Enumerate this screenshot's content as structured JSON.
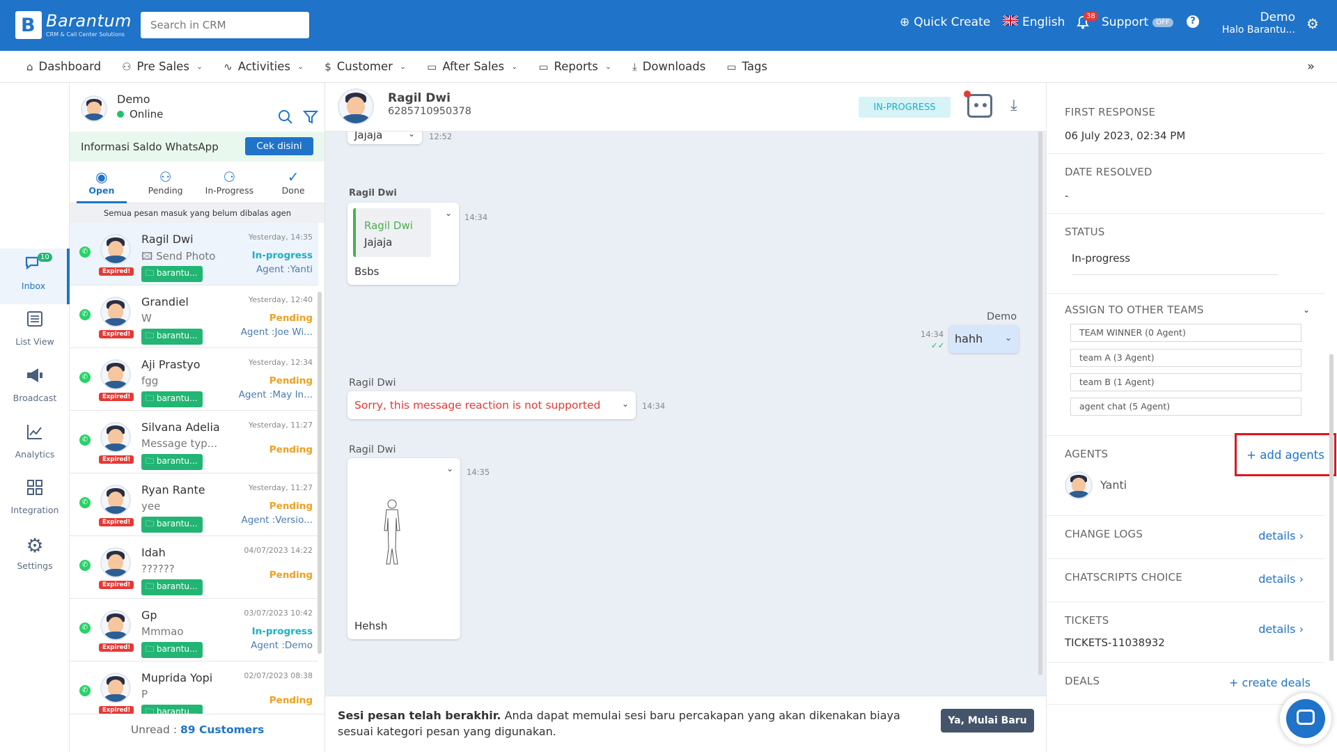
{
  "brand": {
    "name": "Barantum",
    "tagline": "CRM & Call Center Solutions",
    "logo_letter": "B"
  },
  "search": {
    "placeholder": "Search in CRM"
  },
  "topbar": {
    "quick_create": "Quick Create",
    "language": "English",
    "notif_count": "38",
    "support": "Support",
    "support_state": "OFF",
    "help": "?",
    "user_name": "Demo",
    "user_sub": "Halo Barantu..."
  },
  "nav": {
    "items": [
      {
        "label": "Dashboard",
        "icon": "home-icon"
      },
      {
        "label": "Pre Sales",
        "icon": "users-icon",
        "dropdown": true
      },
      {
        "label": "Activities",
        "icon": "activity-icon",
        "dropdown": true
      },
      {
        "label": "Customer",
        "icon": "dollar-icon",
        "dropdown": true
      },
      {
        "label": "After Sales",
        "icon": "folder-icon",
        "dropdown": true
      },
      {
        "label": "Reports",
        "icon": "folder-icon",
        "dropdown": true
      },
      {
        "label": "Downloads",
        "icon": "download-icon"
      },
      {
        "label": "Tags",
        "icon": "folder-icon"
      }
    ],
    "more": "»"
  },
  "rail": {
    "items": [
      {
        "label": "Inbox",
        "badge": "10",
        "active": true
      },
      {
        "label": "List View"
      },
      {
        "label": "Broadcast"
      },
      {
        "label": "Analytics"
      },
      {
        "label": "Integration"
      },
      {
        "label": "Settings"
      }
    ]
  },
  "agent": {
    "name": "Demo",
    "status": "Online"
  },
  "saldo": {
    "text": "Informasi Saldo WhatsApp",
    "button": "Cek disini"
  },
  "tabs": [
    {
      "label": "Open",
      "active": true
    },
    {
      "label": "Pending"
    },
    {
      "label": "In-Progress"
    },
    {
      "label": "Done"
    }
  ],
  "list_note": "Semua pesan masuk yang belum dibalas agen",
  "conversations": [
    {
      "name": "Ragil Dwi",
      "msg": "🖾 Send Photo",
      "time": "Yesterday, 14:35",
      "status": "In-progress",
      "agent": "Agent :Yanti",
      "tag": "barantu...",
      "expired": "Expired!",
      "selected": true
    },
    {
      "name": "Grandiel",
      "msg": "W",
      "time": "Yesterday, 12:40",
      "status": "Pending",
      "agent": "Agent :Joe Wi...",
      "tag": "barantu...",
      "expired": "Expired!"
    },
    {
      "name": "Aji Prastyo",
      "msg": "fgg",
      "time": "Yesterday, 12:34",
      "status": "Pending",
      "agent": "Agent :May In...",
      "tag": "barantu...",
      "expired": "Expired!"
    },
    {
      "name": "Silvana Adelia",
      "msg": "Message typ...",
      "time": "Yesterday, 11:27",
      "status": "Pending",
      "agent": "",
      "tag": "barantu...",
      "expired": "Expired!"
    },
    {
      "name": "Ryan Rante",
      "msg": "yee",
      "time": "Yesterday, 11:27",
      "status": "Pending",
      "agent": "Agent :Versio...",
      "tag": "barantu...",
      "expired": "Expired!"
    },
    {
      "name": "Idah",
      "msg": "??????",
      "time": "04/07/2023 14:22",
      "status": "Pending",
      "agent": "",
      "tag": "barantu...",
      "expired": "Expired!"
    },
    {
      "name": "Gp",
      "msg": "Mmmao",
      "time": "03/07/2023 10:42",
      "status": "In-progress",
      "agent": "Agent :Demo",
      "tag": "barantu...",
      "expired": "Expired!"
    },
    {
      "name": "Muprida Yopi",
      "msg": "P",
      "time": "02/07/2023 08:38",
      "status": "Pending",
      "agent": "",
      "tag": "barantu...",
      "expired": "Expired!"
    }
  ],
  "unread": {
    "label": "Unread :",
    "value": "89 Customers"
  },
  "chat": {
    "contact_name": "Ragil Dwi",
    "contact_phone": "6285710950378",
    "status": "IN-PROGRESS",
    "messages": {
      "m0": {
        "text": "Jajaja",
        "time": "12:52"
      },
      "m1": {
        "sender": "Ragil Dwi",
        "quote_name": "Ragil Dwi",
        "quote_text": "Jajaja",
        "text": "Bsbs",
        "time": "14:34"
      },
      "m2": {
        "sender": "Demo",
        "text": "hahh",
        "time": "14:34"
      },
      "m3": {
        "sender": "Ragil Dwi",
        "text": "Sorry, this message reaction is not supported",
        "time": "14:34"
      },
      "m4": {
        "sender": "Ragil Dwi",
        "caption": "Hehsh",
        "time": "14:35"
      }
    },
    "session_end": {
      "bold": "Sesi pesan telah berakhir.",
      "text": " Anda dapat memulai sesi baru percakapan yang akan dikenakan biaya sesuai kategori pesan yang digunakan.",
      "button": "Ya, Mulai Baru"
    }
  },
  "details": {
    "first_response": {
      "label": "FIRST RESPONSE",
      "value": "06 July 2023, 02:34 PM"
    },
    "date_resolved": {
      "label": "DATE RESOLVED",
      "value": "-"
    },
    "status": {
      "label": "STATUS",
      "value": "In-progress"
    },
    "assign": {
      "label": "ASSIGN TO OTHER TEAMS",
      "teams": [
        "TEAM WINNER (0 Agent)",
        "team A (3 Agent)",
        "team B (1 Agent)",
        "agent chat (5 Agent)"
      ]
    },
    "agents": {
      "label": "AGENTS",
      "add": "+ add agents",
      "list": [
        "Yanti"
      ]
    },
    "change_logs": {
      "label": "CHANGE LOGS",
      "link": "details"
    },
    "chatscripts": {
      "label": "CHATSCRIPTS CHOICE",
      "link": "details"
    },
    "tickets": {
      "label": "TICKETS",
      "value": "TICKETS-11038932",
      "link": "details"
    },
    "deals": {
      "label": "DEALS",
      "link": "+ create deals"
    }
  },
  "colors": {
    "primary": "#1f73c9",
    "in_progress": "#1ab2c4",
    "pending": "#f0a020",
    "whatsapp": "#25d366",
    "expired": "#e53935",
    "highlight": "#e0151e"
  }
}
